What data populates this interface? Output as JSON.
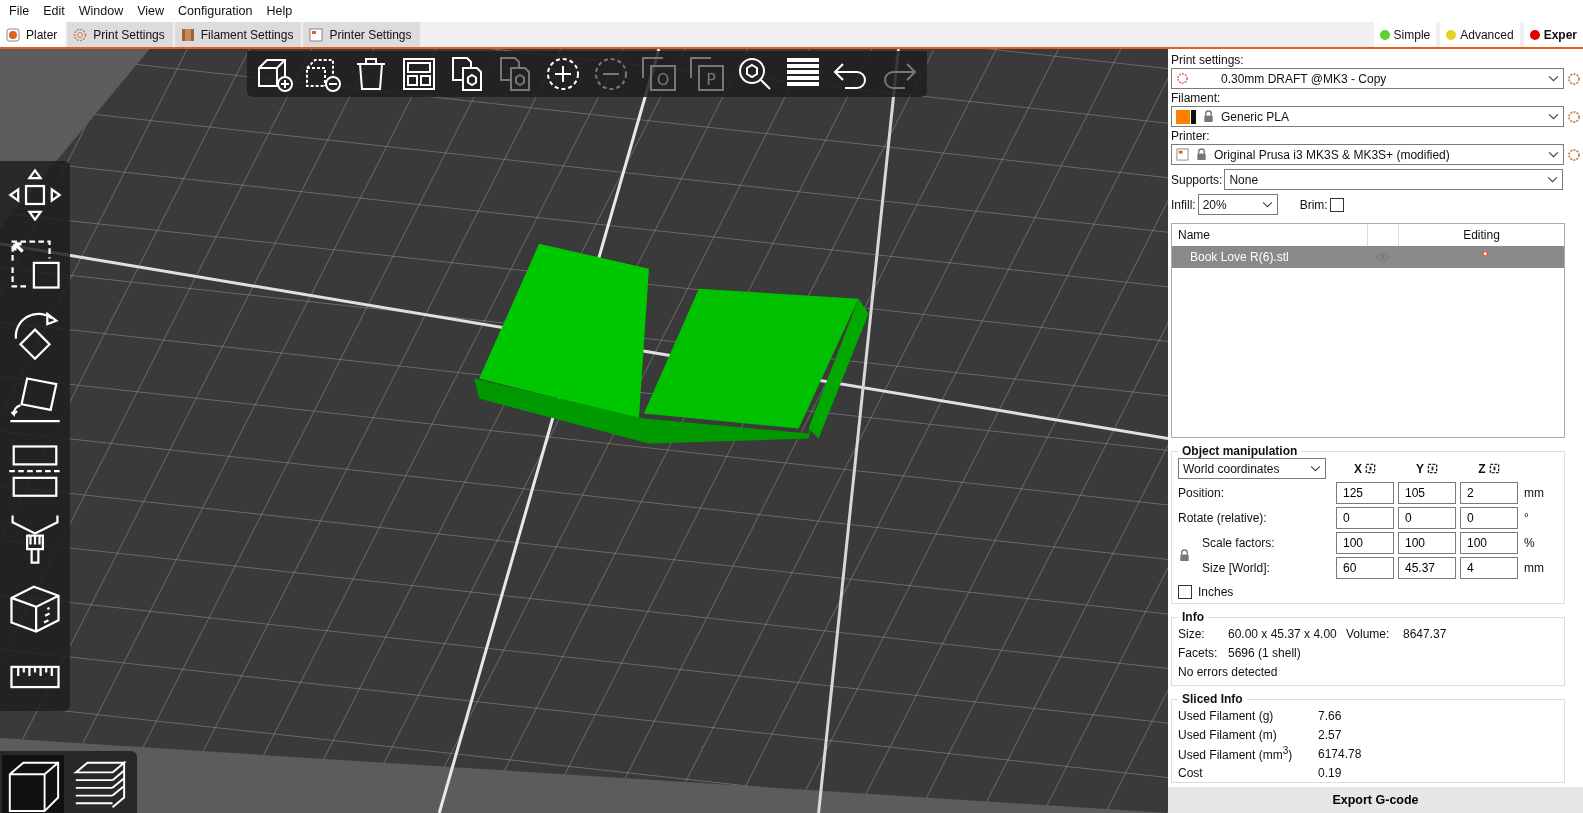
{
  "menu": [
    "File",
    "Edit",
    "Window",
    "View",
    "Configuration",
    "Help"
  ],
  "tabs": [
    {
      "label": "Plater",
      "kind": "plater",
      "selected": true
    },
    {
      "label": "Print Settings",
      "kind": "print",
      "selected": false
    },
    {
      "label": "Filament Settings",
      "kind": "filament",
      "selected": false
    },
    {
      "label": "Printer Settings",
      "kind": "printer",
      "selected": false
    }
  ],
  "modes": [
    {
      "label": "Simple",
      "color": "#5bd32a"
    },
    {
      "label": "Advanced",
      "color": "#e6d21e"
    },
    {
      "label": "Exper",
      "color": "#e00000"
    }
  ],
  "viewport": {
    "kind": "picture",
    "top_toolbar": [
      {
        "kind": "add",
        "disabled": false
      },
      {
        "kind": "delete",
        "disabled": false
      },
      {
        "kind": "delete_all",
        "disabled": false
      },
      {
        "kind": "arrange",
        "disabled": false
      },
      {
        "kind": "copy",
        "disabled": false
      },
      {
        "kind": "paste",
        "disabled": true
      },
      {
        "kind": "instance_add",
        "disabled": false
      },
      {
        "kind": "instance_remove",
        "disabled": true
      },
      {
        "kind": "split_objects",
        "glyph": "O",
        "disabled": true
      },
      {
        "kind": "split_parts",
        "glyph": "P",
        "disabled": true
      },
      {
        "kind": "search",
        "disabled": false
      },
      {
        "kind": "layers",
        "disabled": false
      },
      {
        "kind": "undo",
        "disabled": false
      },
      {
        "kind": "redo",
        "disabled": true
      }
    ],
    "left_toolbar": [
      {
        "kind": "move"
      },
      {
        "kind": "scale"
      },
      {
        "kind": "rotate"
      },
      {
        "kind": "lay_on_face"
      },
      {
        "kind": "cut"
      },
      {
        "kind": "paint"
      },
      {
        "kind": "cube"
      },
      {
        "kind": "measure"
      }
    ],
    "view_toggle": [
      {
        "kind": "view3d",
        "selected": true
      },
      {
        "kind": "preview",
        "selected": false
      }
    ]
  },
  "presets": [
    {
      "label": "Print settings:",
      "kind": "print",
      "value": "0.30mm DRAFT @MK3 - Copy"
    },
    {
      "label": "Filament:",
      "kind": "filament",
      "value": "Generic PLA"
    },
    {
      "label": "Printer:",
      "kind": "printer",
      "value": "Original Prusa i3 MK3S & MK3S+ (modified)"
    }
  ],
  "supports": {
    "label": "Supports:",
    "value": "None"
  },
  "infill": {
    "label": "Infill:",
    "value": "20%"
  },
  "brim": {
    "label": "Brim:",
    "checked": false
  },
  "object_list": {
    "columns": [
      "Name",
      "Editing"
    ],
    "rows": [
      {
        "name": "Book Love R(6).stl",
        "selected": true
      }
    ]
  },
  "object_manipulation": {
    "title": "Object manipulation",
    "coordinates": "World coordinates",
    "axes": [
      "X",
      "Y",
      "Z"
    ],
    "rows": [
      {
        "label": "Position:",
        "values": [
          "125",
          "105",
          "2"
        ],
        "unit": "mm"
      },
      {
        "label": "Rotate (relative):",
        "values": [
          "0",
          "0",
          "0"
        ],
        "unit": "°"
      },
      {
        "label": "Scale factors:",
        "values": [
          "100",
          "100",
          "100"
        ],
        "unit": "%"
      },
      {
        "label": "Size [World]:",
        "values": [
          "60",
          "45.37",
          "4"
        ],
        "unit": "mm"
      }
    ],
    "inches": {
      "label": "Inches",
      "checked": false
    }
  },
  "info": {
    "title": "Info",
    "size_label": "Size:",
    "size": "60.00 x 45.37 x 4.00",
    "volume_label": "Volume:",
    "volume": "8647.37",
    "facets_label": "Facets:",
    "facets": "5696 (1 shell)",
    "status": "No errors detected"
  },
  "sliced_info": {
    "title": "Sliced Info",
    "rows": [
      {
        "label": "Used Filament (g)",
        "value": "7.66"
      },
      {
        "label": "Used Filament (m)",
        "value": "2.57"
      },
      {
        "label": "Used Filament (mm$^{3}$)",
        "value": "6174.78"
      },
      {
        "label": "Cost",
        "value": "0.19"
      }
    ]
  },
  "export_button": "Export G-code"
}
